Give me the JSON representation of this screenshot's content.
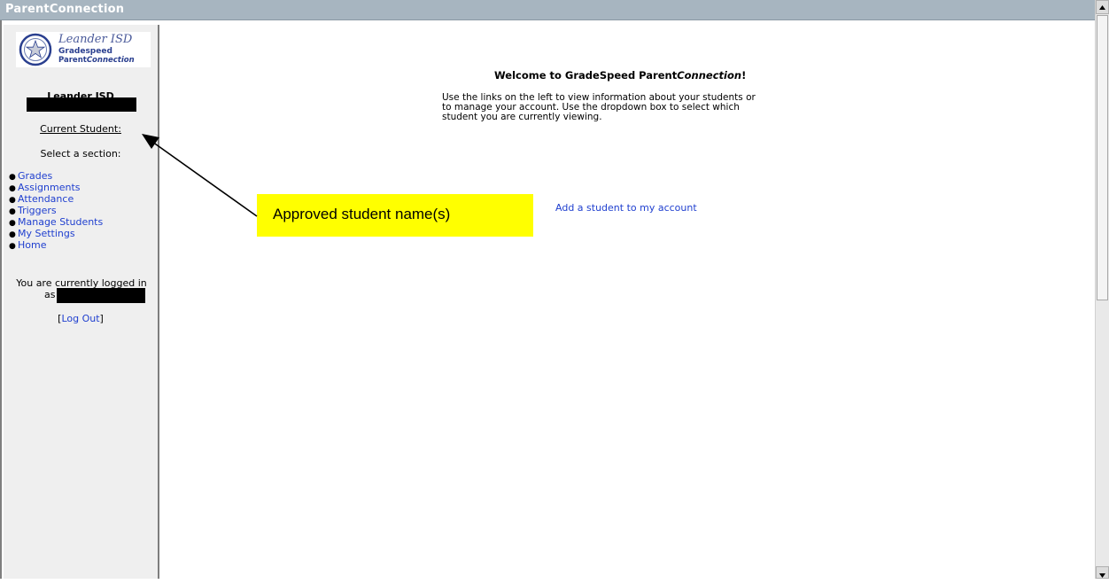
{
  "app": {
    "title": "ParentConnection"
  },
  "logo": {
    "district": "Leander ISD",
    "line2": "Gradespeed",
    "line3_a": "Parent",
    "line3_b": "Connection"
  },
  "sidebar": {
    "district_name": "Leander ISD",
    "current_student_label": "Current Student:",
    "select_section_label": "Select a section:",
    "nav": [
      {
        "label": "Grades"
      },
      {
        "label": "Assignments"
      },
      {
        "label": "Attendance"
      },
      {
        "label": "Triggers"
      },
      {
        "label": "Manage Students"
      },
      {
        "label": "My Settings"
      },
      {
        "label": "Home"
      }
    ],
    "logged_in_line1": "You are currently logged in",
    "logged_in_as": "as",
    "logout_open": "[",
    "logout_label": "Log Out",
    "logout_close": "]"
  },
  "main": {
    "welcome_prefix": "Welcome to GradeSpeed Parent",
    "welcome_italic": "Connection",
    "welcome_suffix": "!",
    "welcome_lines": [
      "Use the links on the left to view information about your students or",
      "to manage your account.   Use the dropdown box to select which",
      "student you are currently viewing."
    ],
    "add_student_link": "Add a student to my account"
  },
  "annotation": {
    "callout_text": "Approved student name(s)",
    "callout_color": "#ffff00"
  },
  "colors": {
    "link": "#1f3fcf",
    "titlebar": "#a7b5c0"
  }
}
